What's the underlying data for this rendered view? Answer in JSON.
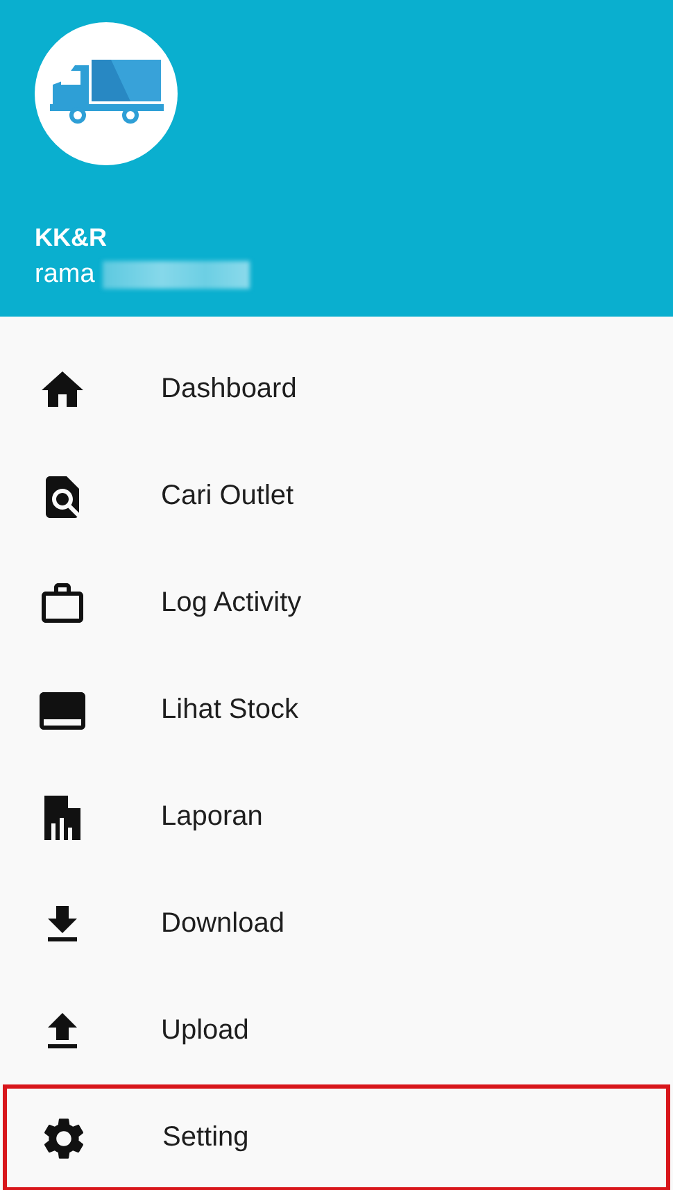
{
  "header": {
    "title": "KK&R",
    "user": {
      "name": "rama",
      "redacted": true
    }
  },
  "menu": [
    {
      "label": "Dashboard",
      "highlighted": false
    },
    {
      "label": "Cari Outlet",
      "highlighted": false
    },
    {
      "label": "Log Activity",
      "highlighted": false
    },
    {
      "label": "Lihat Stock",
      "highlighted": false
    },
    {
      "label": "Laporan",
      "highlighted": false
    },
    {
      "label": "Download",
      "highlighted": false
    },
    {
      "label": "Upload",
      "highlighted": false
    },
    {
      "label": "Setting",
      "highlighted": true
    }
  ]
}
